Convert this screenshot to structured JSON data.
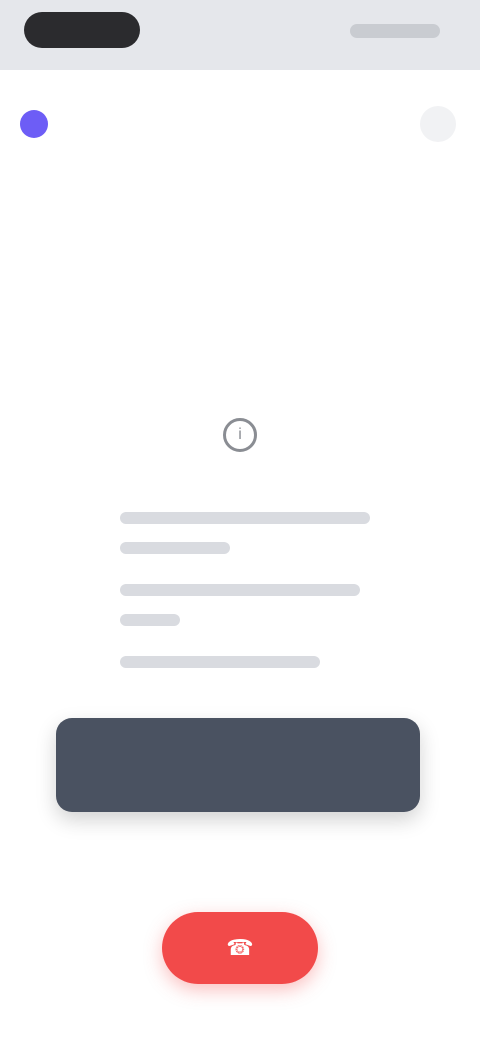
{
  "status_bar": {
    "time": "",
    "icons": [
      "signal-icon",
      "wifi-icon",
      "battery-icon"
    ]
  },
  "header": {
    "brand_name": "",
    "menu_icon": "menu-icon"
  },
  "main": {
    "icon": "info-icon",
    "title": "",
    "body_lines": [
      "",
      "",
      "",
      "",
      ""
    ]
  },
  "actions": {
    "primary_label": "",
    "secondary_label": "",
    "end_icon": "phone-hangup-icon"
  },
  "colors": {
    "brand": "#6d5df6",
    "primary_button": "#4a5261",
    "end_button": "#f24a4a",
    "status_bar": "#e5e7eb"
  }
}
